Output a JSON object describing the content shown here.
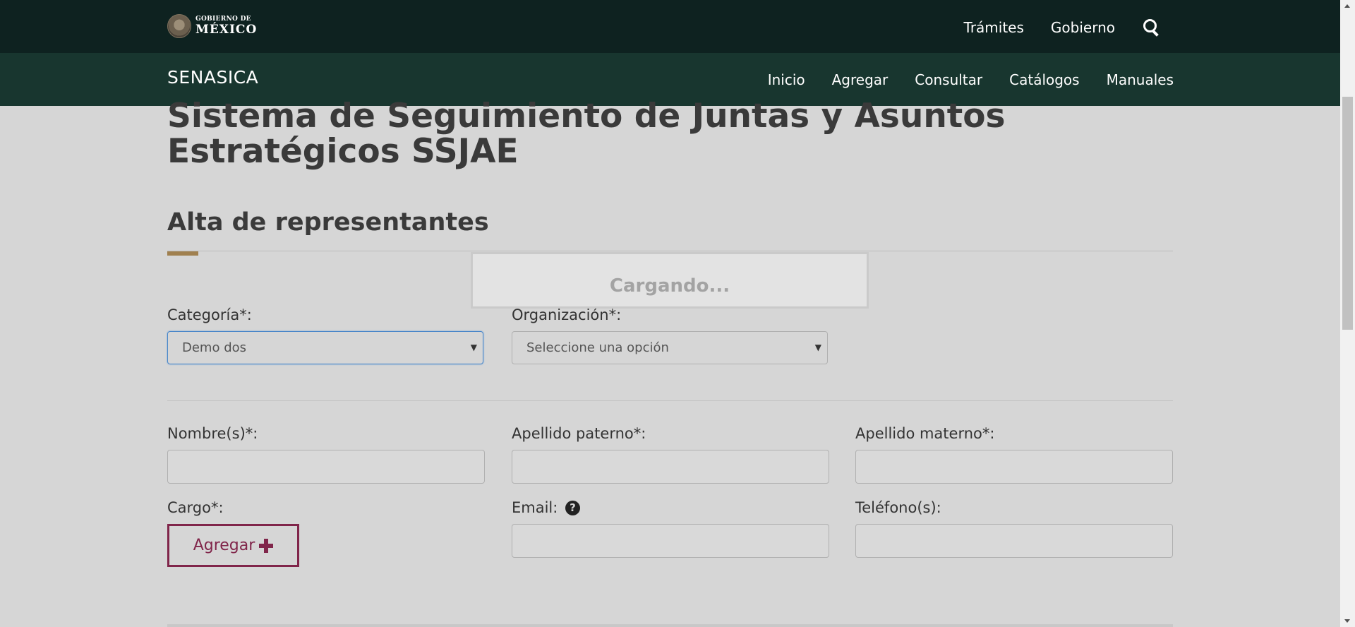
{
  "header": {
    "logo": {
      "line1": "GOBIERNO DE",
      "line2": "MÉXICO",
      "icon": "mexico-seal-icon"
    },
    "nav": [
      {
        "label": "Trámites"
      },
      {
        "label": "Gobierno"
      }
    ],
    "search_icon": "search-icon"
  },
  "subnav": {
    "brand": "SENASICA",
    "links": [
      {
        "label": "Inicio"
      },
      {
        "label": "Agregar"
      },
      {
        "label": "Consultar"
      },
      {
        "label": "Catálogos"
      },
      {
        "label": "Manuales"
      }
    ]
  },
  "page": {
    "title": "Sistema de Seguimiento de Juntas y Asuntos Estratégicos SSJAE",
    "section_title": "Alta de representantes"
  },
  "form": {
    "categoria": {
      "label": "Categoría*:",
      "value": "Demo dos"
    },
    "organizacion": {
      "label": "Organización*:",
      "value": "Seleccione una opción"
    },
    "nombre": {
      "label": "Nombre(s)*:",
      "value": ""
    },
    "apellido_paterno": {
      "label": "Apellido paterno*:",
      "value": ""
    },
    "apellido_materno": {
      "label": "Apellido materno*:",
      "value": ""
    },
    "cargo": {
      "label": "Cargo*:"
    },
    "email": {
      "label": "Email:",
      "value": "",
      "help_icon": "question-circle-icon"
    },
    "telefono": {
      "label": "Teléfono(s):",
      "value": ""
    },
    "add_button": {
      "label": "Agregar",
      "icon": "plus-icon"
    }
  },
  "loading": {
    "text": "Cargando..."
  },
  "colors": {
    "topbar": "#0e2220",
    "subnav": "#18362f",
    "accent": "#a0804f",
    "button": "#80254a",
    "background": "#d6d6d6"
  }
}
